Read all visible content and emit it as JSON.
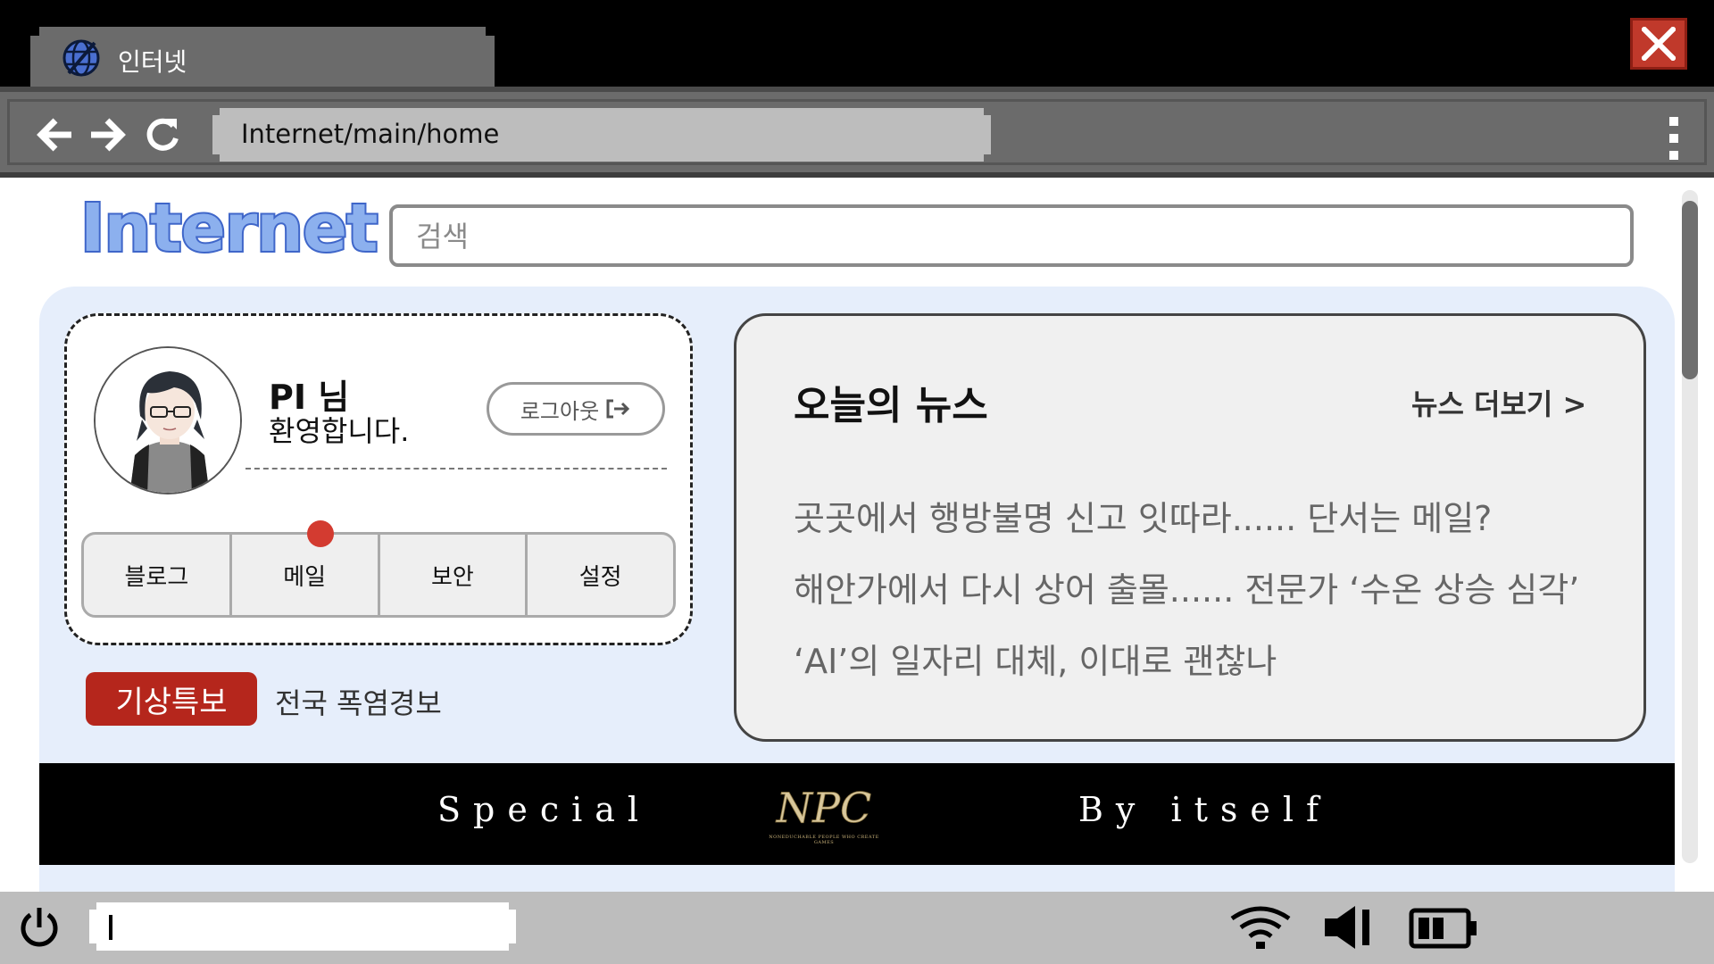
{
  "tab": {
    "label": "인터넷",
    "icon": "globe-icon"
  },
  "window": {
    "close_icon": "close-icon",
    "close_color": "#c0392b"
  },
  "address_bar": {
    "url": "Internet/main/home",
    "icons": [
      "back-arrow-icon",
      "forward-arrow-icon",
      "reload-icon",
      "kebab-menu-icon"
    ]
  },
  "page": {
    "logo": "Internet",
    "search": {
      "placeholder": "검색",
      "value": ""
    },
    "profile": {
      "name": "PI 님",
      "welcome": "환영합니다.",
      "logout_label": "로그아웃",
      "logout_icon": "logout-icon",
      "quick_menu": [
        {
          "label": "블로그"
        },
        {
          "label": "메일",
          "notification": true
        },
        {
          "label": "보안"
        },
        {
          "label": "설정"
        }
      ]
    },
    "weather": {
      "badge": "기상특보",
      "text": "전국 폭염경보",
      "badge_color": "#b5261c"
    },
    "news": {
      "title": "오늘의 뉴스",
      "more_label": "뉴스 더보기 >",
      "items": [
        "곳곳에서 행방불명 신고 잇따라...... 단서는 메일?",
        "해안가에서 다시 상어 출몰...... 전문가 ‘수온 상승 심각’",
        "‘AI’의 일자리 대체, 이대로 괜찮나"
      ]
    },
    "banner": {
      "left_text": "Special",
      "logo_text": "NPC",
      "logo_subtext": "NONEDUCHABLE PEOPLE WHO CREATE GAMES",
      "right_text": "By itself"
    }
  },
  "taskbar": {
    "input_value": "",
    "icons": [
      "power-icon",
      "wifi-icon",
      "volume-icon",
      "battery-icon"
    ]
  },
  "colors": {
    "accent": "#3f66c9",
    "panel": "#e6eefb",
    "chrome": "#6b6b6b",
    "taskbar": "#bdbdbd"
  }
}
